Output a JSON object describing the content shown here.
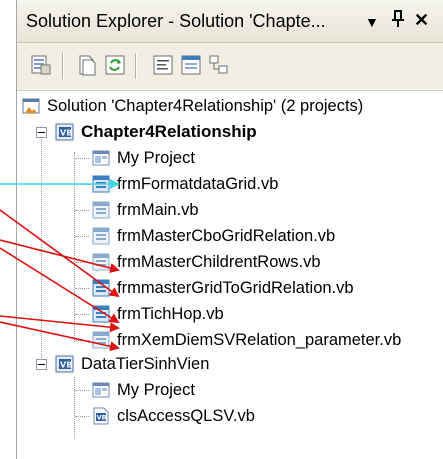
{
  "panel": {
    "title": "Solution Explorer - Solution 'Chapte...",
    "controls": [
      "▼",
      "⊥",
      "✕"
    ]
  },
  "toolbar": {
    "buttons": [
      "properties-icon",
      "show-all-files-icon",
      "refresh-icon",
      "view-code-icon",
      "view-designer-icon",
      "class-diagram-icon"
    ]
  },
  "tree": {
    "solution": "Solution 'Chapter4Relationship' (2 projects)",
    "project1": {
      "name": "Chapter4Relationship",
      "items": [
        "My Project",
        "frmFormatdataGrid.vb",
        "frmMain.vb",
        "frmMasterCboGridRelation.vb",
        "frmMasterChildrentRows.vb",
        "frmmasterGridToGridRelation.vb",
        "frmTichHop.vb",
        "frmXemDiemSVRelation_parameter.vb"
      ]
    },
    "project2": {
      "name": "DataTierSinhVien",
      "items": [
        "My Project",
        "clsAccessQLSV.vb"
      ]
    }
  },
  "colors": {
    "cyan_arrow": "#3fd5e8",
    "red_arrow": "#e01010",
    "form_icon": "#3a7fc0",
    "vb_badge": "#2d5fa3"
  }
}
